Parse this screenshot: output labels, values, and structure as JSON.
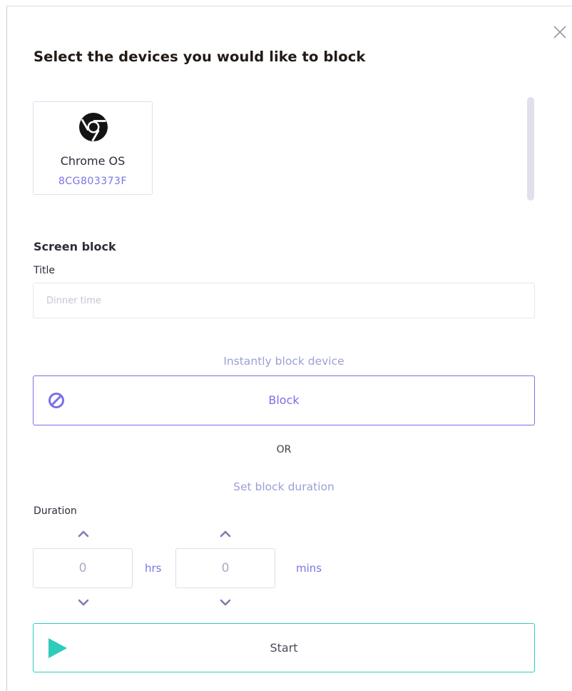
{
  "dialog": {
    "heading": "Select the devices you would like to block",
    "close_icon": "close-icon"
  },
  "devices": [
    {
      "name": "Chrome OS",
      "serial": "8CG803373F",
      "icon": "chrome-icon"
    }
  ],
  "screen_block": {
    "section_title": "Screen block",
    "title_label": "Title",
    "title_value": "",
    "title_placeholder": "Dinner time",
    "instant_hint": "Instantly block device",
    "block_label": "Block",
    "block_icon": "block-icon",
    "or_text": "OR",
    "duration_hint": "Set block duration",
    "duration_label": "Duration",
    "hours_value": "0",
    "hours_unit": "hrs",
    "minutes_value": "0",
    "minutes_unit": "mins",
    "start_label": "Start",
    "start_icon": "play-icon"
  },
  "colors": {
    "accent": "#7b6fe6",
    "start_accent": "#2fcbbb",
    "hint": "#9b9fd6",
    "heading": "#231a16"
  }
}
